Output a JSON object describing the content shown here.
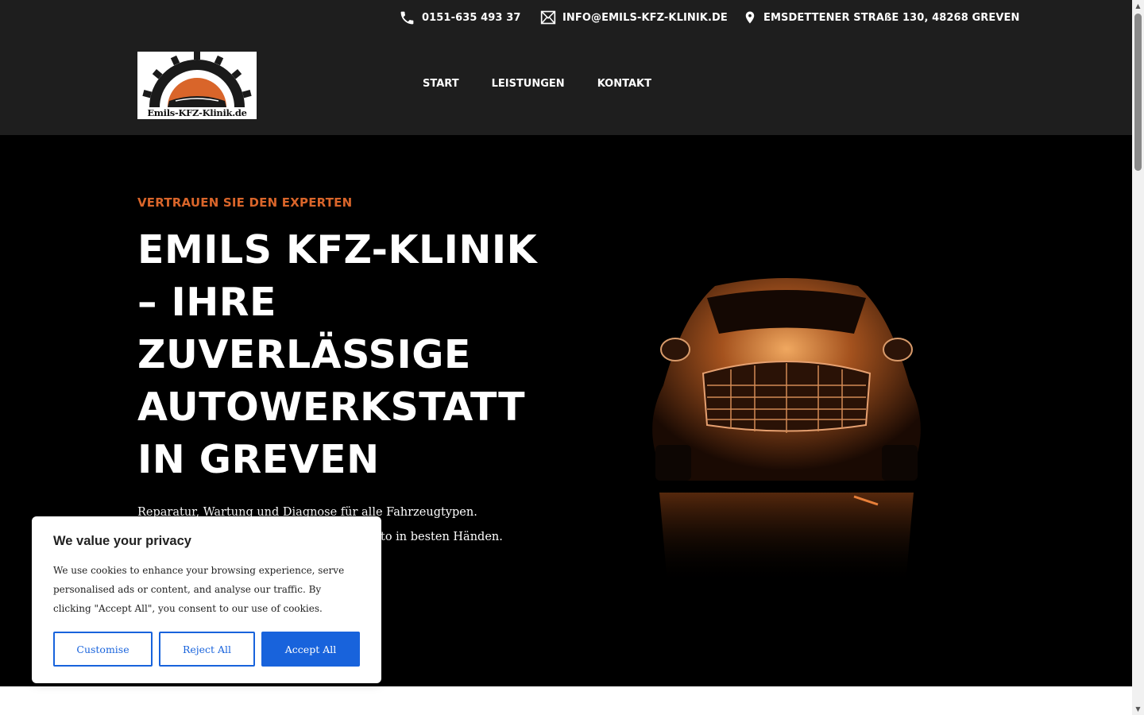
{
  "topbar": {
    "phone": "0151-635 493 37",
    "email": "INFO@EMILS-KFZ-KLINIK.DE",
    "address": "EMSDETTENER STRAßE 130, 48268 GREVEN"
  },
  "logo": {
    "text": "Emils-KFZ-Klinik.de"
  },
  "nav": {
    "items": [
      "START",
      "LEISTUNGEN",
      "KONTAKT"
    ]
  },
  "hero": {
    "eyebrow": "VERTRAUEN SIE DEN EXPERTEN",
    "headline": "EMILS KFZ-KLINIK – IHRE ZUVERLÄSSIGE AUTOWERKSTATT IN GREVEN",
    "subtext_line1": "Reparatur, Wartung und Diagnose für alle Fahrzeugtypen.",
    "subtext_line2_visible": "to in besten Händen."
  },
  "cookie": {
    "title": "We value your privacy",
    "text": "We use cookies to enhance your browsing experience, serve personalised ads or content, and analyse our traffic. By clicking \"Accept All\", you consent to our use of cookies.",
    "customise": "Customise",
    "reject": "Reject All",
    "accept": "Accept All"
  },
  "colors": {
    "header_bg": "#1e1e1e",
    "hero_bg": "#000000",
    "accent": "#d9652a",
    "cookie_blue": "#1863dc"
  },
  "icons": [
    "phone-icon",
    "mail-icon",
    "location-pin-icon"
  ]
}
